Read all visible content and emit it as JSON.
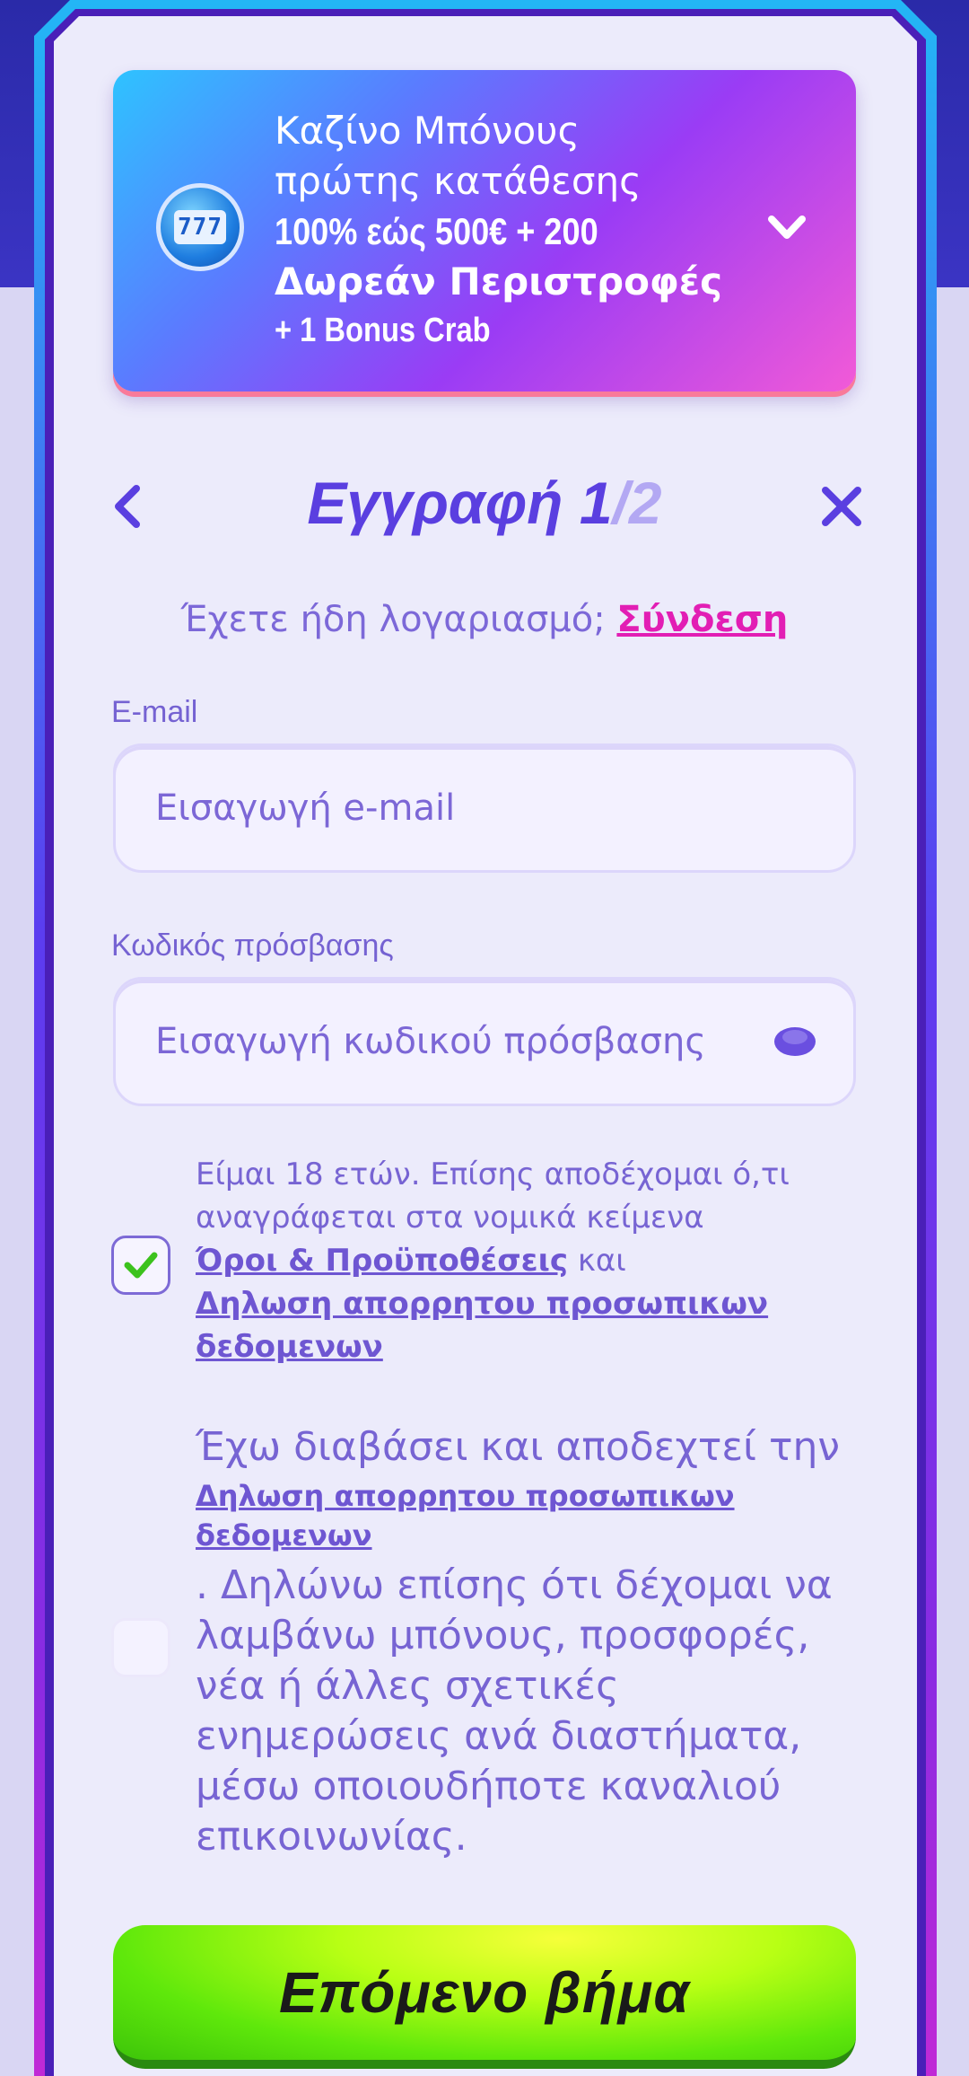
{
  "bonus_banner": {
    "line1": "Καζίνο Μπόνους",
    "line2": "πρώτης κατάθεσης",
    "line3": "100% εώς 500€ + 200",
    "line4": "Δωρεάν Περιστροφές",
    "line5": "+ 1 Bonus Crab",
    "icon_text": "777"
  },
  "header": {
    "title": "Εγγραφή",
    "step_current": "1",
    "step_total": "/2"
  },
  "login_prompt": {
    "text": "Έχετε ήδη λογαριασμό;",
    "link": "Σύνδεση"
  },
  "email": {
    "label": "E-mail",
    "placeholder": "Εισαγωγή e-mail"
  },
  "password": {
    "label": "Κωδικός πρόσβασης",
    "placeholder": "Εισαγωγή κωδικού πρόσβασης"
  },
  "consent_terms": {
    "checked": true,
    "text": "Είμαι 18 ετών. Επίσης αποδέχομαι ό,τι αναγράφεται στα νομικά κείμενα",
    "link1": "Όροι & Προϋποθέσεις",
    "joiner": "και",
    "link2": "Δηλωση απορρητου προσωπικων δεδομενων"
  },
  "consent_marketing": {
    "checked": false,
    "text_before": "Έχω διαβάσει και αποδεχτεί την",
    "link": "Δηλωση απορρητου προσωπικων δεδομενων",
    "text_after": ". Δηλώνω επίσης ότι δέχομαι να λαμβάνω μπόνους, προσφορές, νέα ή άλλες σχετικές ενημερώσεις ανά διαστήματα, μέσω οποιουδήποτε καναλιού επικοινωνίας."
  },
  "next_button": {
    "label": "Επόμενο βήμα"
  },
  "colors": {
    "accent": "#5a3fe0",
    "link": "#e21eb4",
    "button": "#5fe80b"
  }
}
